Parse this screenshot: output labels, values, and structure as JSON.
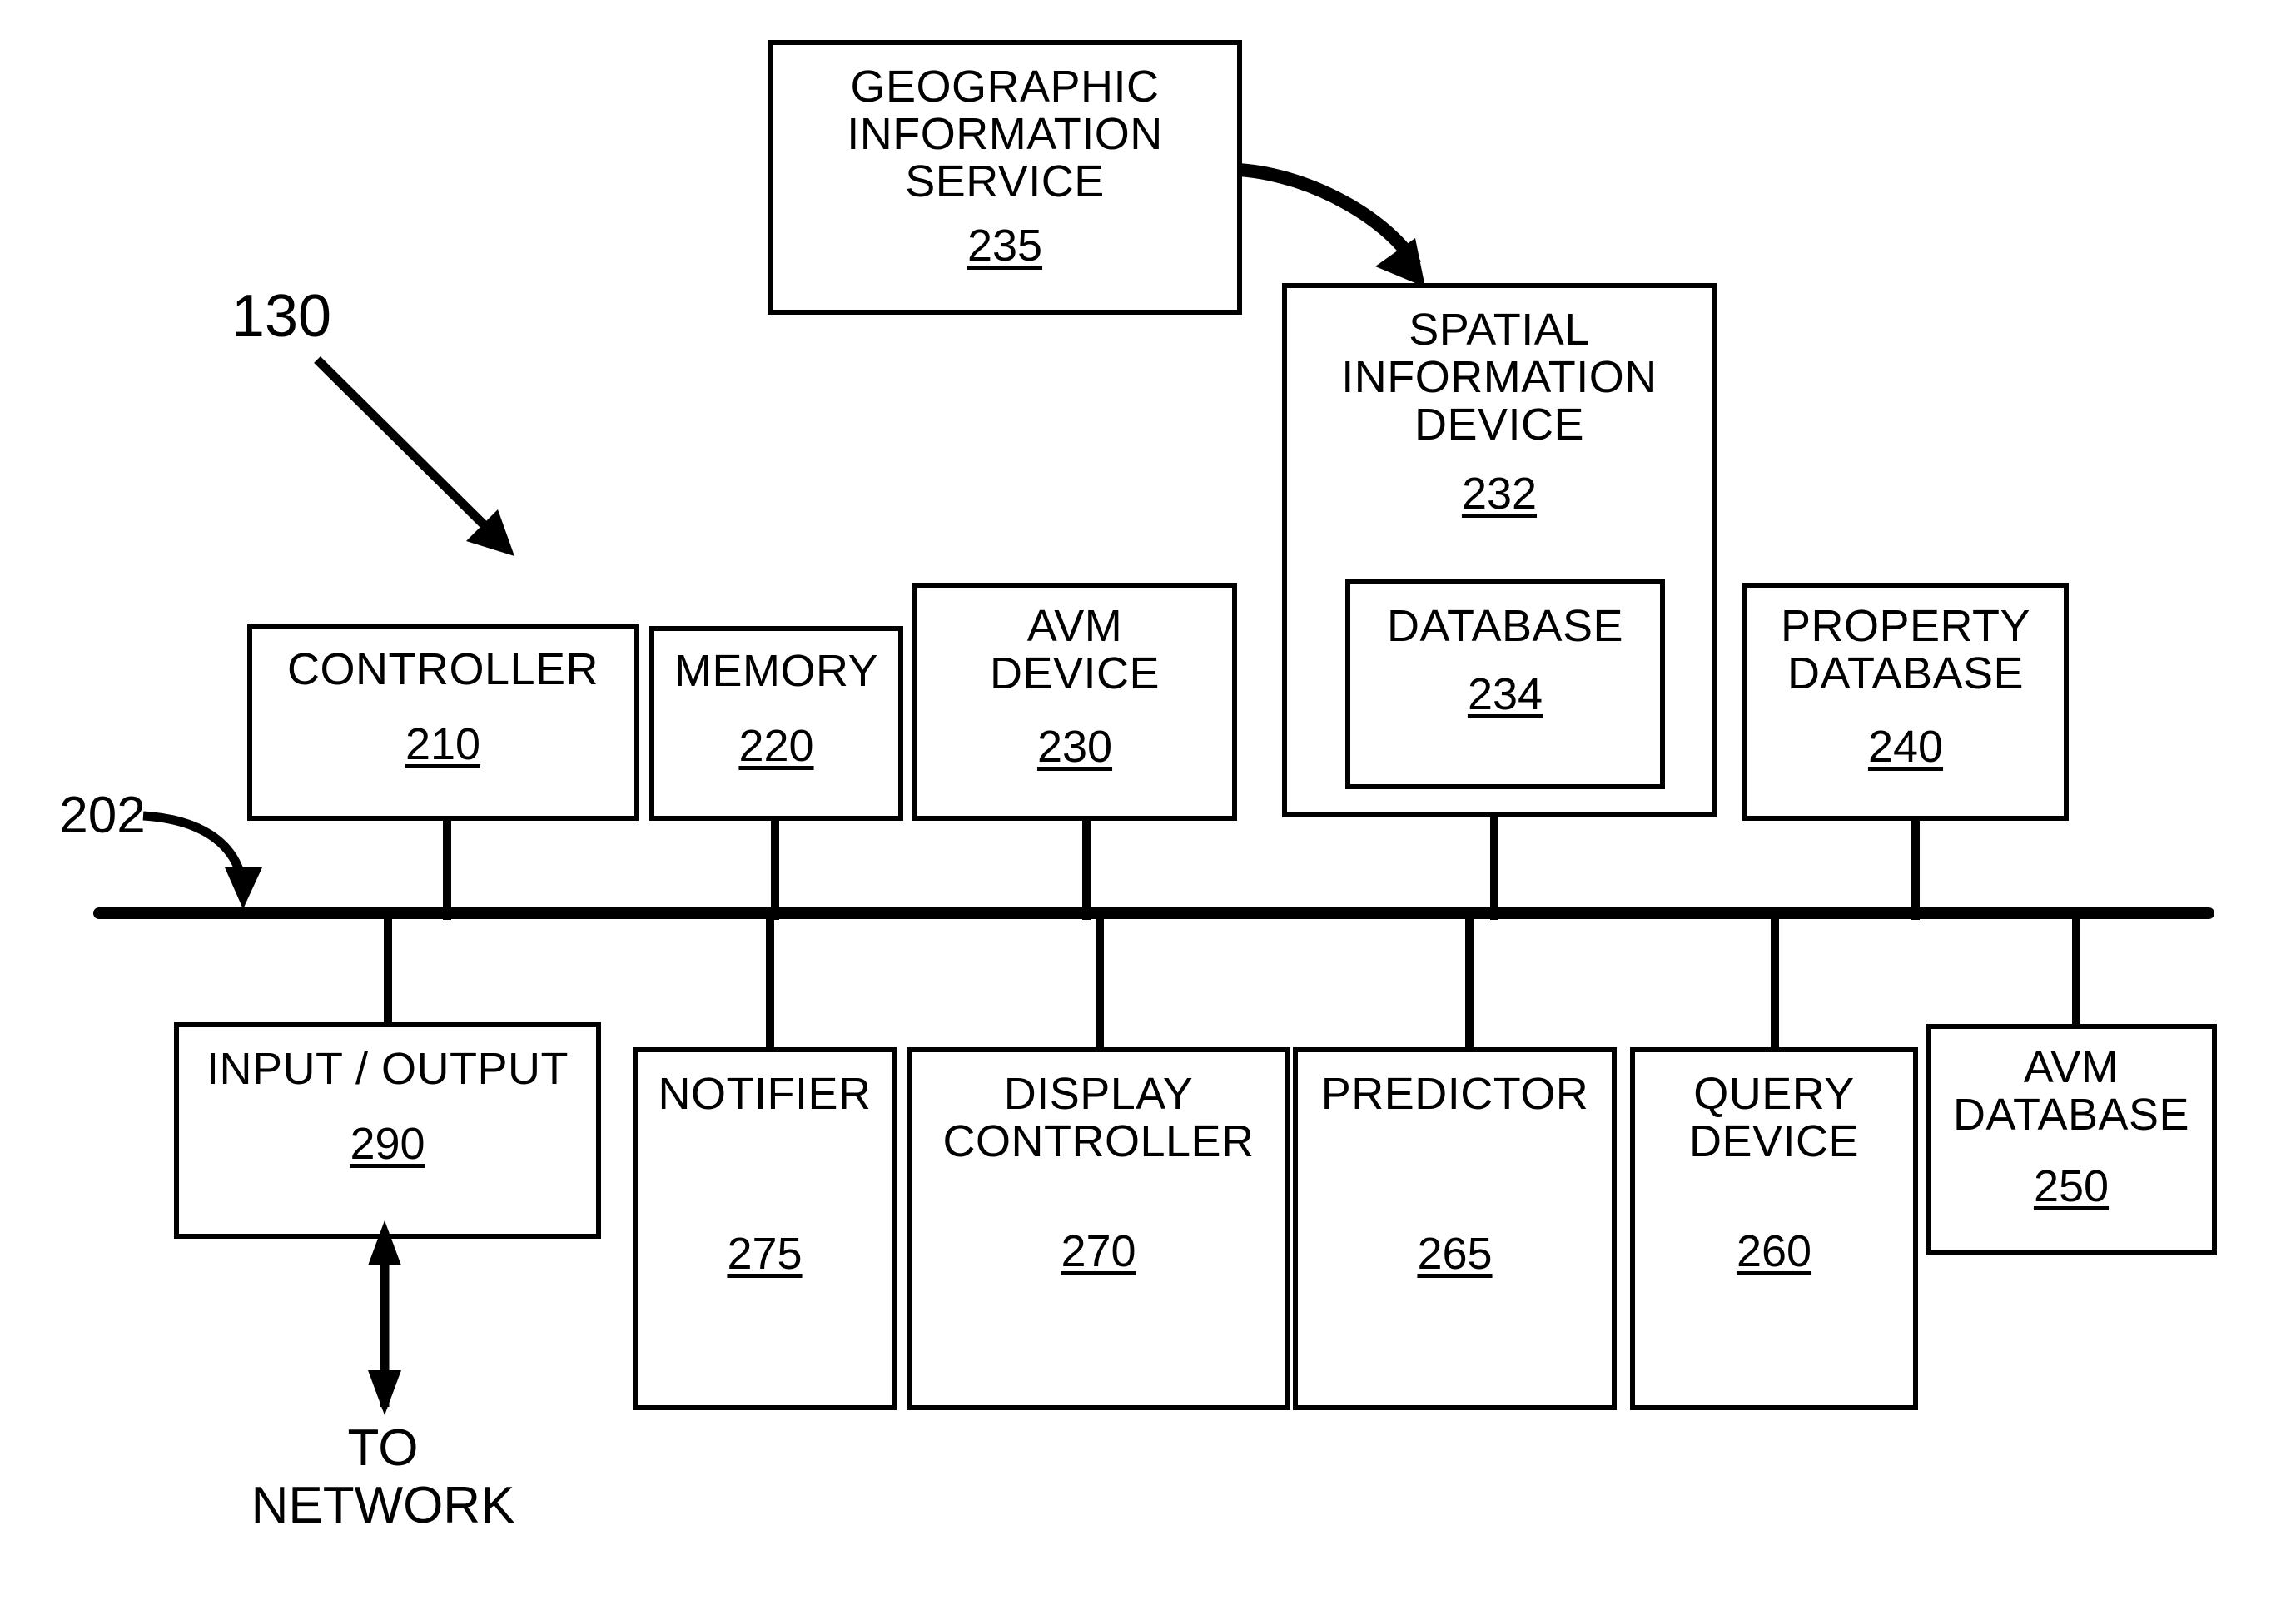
{
  "figure": {
    "system_label": "130",
    "bus_label": "202",
    "network_label": "TO\nNETWORK"
  },
  "blocks": {
    "geographic_information_service": {
      "title": "GEOGRAPHIC\nINFORMATION\nSERVICE",
      "refnum": "235"
    },
    "spatial_information_device": {
      "title": "SPATIAL\nINFORMATION\nDEVICE",
      "refnum": "232"
    },
    "database": {
      "title": "DATABASE",
      "refnum": "234"
    },
    "controller": {
      "title": "CONTROLLER",
      "refnum": "210"
    },
    "memory": {
      "title": "MEMORY",
      "refnum": "220"
    },
    "avm_device": {
      "title": "AVM\nDEVICE",
      "refnum": "230"
    },
    "property_database": {
      "title": "PROPERTY\nDATABASE",
      "refnum": "240"
    },
    "input_output": {
      "title": "INPUT / OUTPUT",
      "refnum": "290"
    },
    "notifier": {
      "title": "NOTIFIER",
      "refnum": "275"
    },
    "display_controller": {
      "title": "DISPLAY\nCONTROLLER",
      "refnum": "270"
    },
    "predictor": {
      "title": "PREDICTOR",
      "refnum": "265"
    },
    "query_device": {
      "title": "QUERY\nDEVICE",
      "refnum": "260"
    },
    "avm_database": {
      "title": "AVM\nDATABASE",
      "refnum": "250"
    }
  },
  "colors": {
    "ink": "#000000",
    "paper": "#ffffff"
  }
}
